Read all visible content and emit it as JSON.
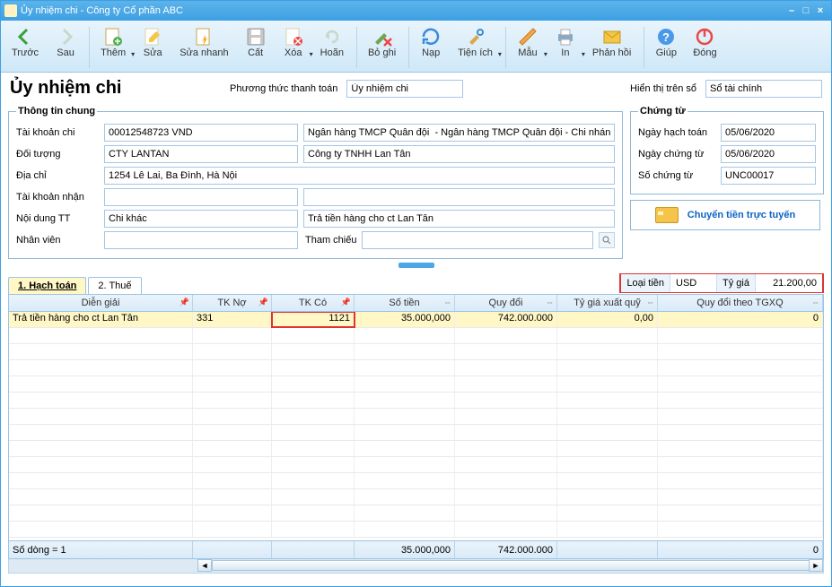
{
  "window": {
    "title": "Ủy nhiệm chi - Công ty Cổ phần ABC"
  },
  "toolbar": {
    "prev": "Trước",
    "next": "Sau",
    "add": "Thêm",
    "edit": "Sửa",
    "quick_edit": "Sửa nhanh",
    "cut": "Cất",
    "delete": "Xóa",
    "undo": "Hoãn",
    "unpost": "Bỏ ghi",
    "load": "Nạp",
    "util": "Tiện ích",
    "template": "Mẫu",
    "print": "In",
    "feedback": "Phản hồi",
    "help": "Giúp",
    "close": "Đóng"
  },
  "header": {
    "page_title": "Ủy nhiệm chi",
    "pay_method_label": "Phương thức thanh toán",
    "pay_method_value": "Ủy nhiệm chi",
    "display_book_label": "Hiển thị trên sổ",
    "display_book_value": "Sổ tài chính"
  },
  "general": {
    "legend": "Thông tin chung",
    "account_pay_label": "Tài khoản chi",
    "account_pay_value": "00012548723 VND",
    "bank_value": "Ngân hàng TMCP Quân đội  - Ngân hàng TMCP Quân đội - Chi nhánh Th",
    "object_label": "Đối tượng",
    "object_code": "CTY LANTAN",
    "object_name": "Công ty TNHH Lan Tân",
    "address_label": "Địa chỉ",
    "address_value": "1254 Lê Lai, Ba Đình, Hà Nội",
    "account_recv_label": "Tài khoản nhận",
    "content_label": "Nội dung TT",
    "content_code": "Chi khác",
    "content_text": "Trả tiền hàng cho ct Lan Tân",
    "staff_label": "Nhân viên",
    "ref_label": "Tham chiếu"
  },
  "voucher": {
    "legend": "Chứng từ",
    "posted_date_label": "Ngày hạch toán",
    "posted_date": "05/06/2020",
    "voucher_date_label": "Ngày chứng từ",
    "voucher_date": "05/06/2020",
    "voucher_no_label": "Số chứng từ",
    "voucher_no": "UNC00017",
    "online_transfer": "Chuyển tiền trực tuyến"
  },
  "currency": {
    "type_label": "Loại tiền",
    "type": "USD",
    "rate_label": "Tỷ giá",
    "rate": "21.200,00"
  },
  "tabs": {
    "t1": "1. Hạch toán",
    "t2": "2. Thuế"
  },
  "grid": {
    "headers": {
      "desc": "Diễn giải",
      "tk_no": "TK Nợ",
      "tk_co": "TK Có",
      "amount": "Số tiền",
      "converted": "Quy đổi",
      "rate_out": "Tỷ giá xuất quỹ",
      "conv_out": "Quy đổi theo TGXQ"
    },
    "row": {
      "desc": "Trả tiền hàng cho ct Lan Tân",
      "tk_no": "331",
      "tk_co": "1121",
      "amount": "35.000,000",
      "converted": "742.000.000",
      "rate_out": "0,00",
      "conv_out": "0"
    },
    "footer": {
      "rowcount": "Số dòng = 1",
      "sum_amount": "35.000,000",
      "sum_converted": "742.000.000",
      "sum_conv_out": "0"
    }
  }
}
